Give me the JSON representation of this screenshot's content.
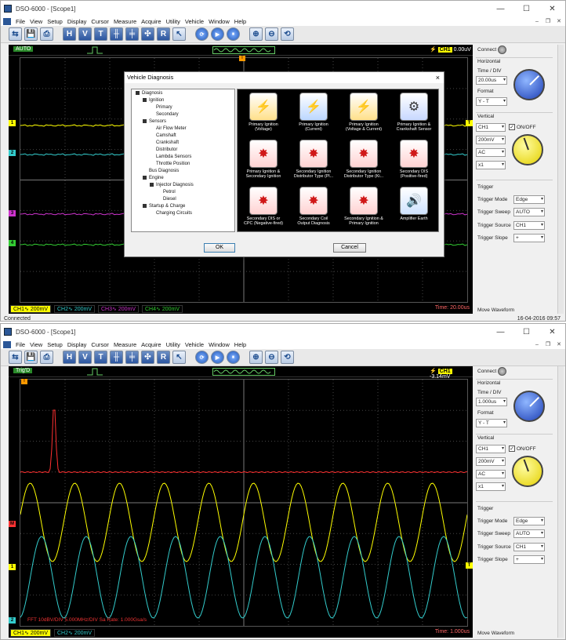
{
  "window1": {
    "title": "DSO-6000 - [Scope1]",
    "menu": [
      "File",
      "View",
      "Setup",
      "Display",
      "Cursor",
      "Measure",
      "Acquire",
      "Utility",
      "Vehicle",
      "Window",
      "Help"
    ],
    "mode_badge": "AUTO",
    "trigger_level": "0.00uV",
    "ch_tags": [
      "CH1∿ 200mV",
      "CH2∿ 200mV",
      "CH3∿ 200mV",
      "CH4∿ 200mV"
    ],
    "time_readout": "Time: 20.00us",
    "status": "Connected",
    "datetime": "16-04-2016   09:57",
    "side": {
      "connect": "Connect",
      "horizontal": "Horizontal",
      "time_div_label": "Time / DIV",
      "time_div": "20.00us",
      "format_label": "Format",
      "format": "Y - T",
      "vertical": "Vertical",
      "channel": "CH1",
      "on_off": "ON/OFF",
      "volts": "200mV",
      "coupling": "AC",
      "probe": "x1",
      "trigger": "Trigger",
      "trigger_mode_label": "Trigger Mode",
      "trigger_mode": "Edge",
      "trigger_sweep_label": "Trigger Sweep",
      "trigger_sweep": "AUTO",
      "trigger_source_label": "Trigger Source",
      "trigger_source": "CH1",
      "trigger_slope_label": "Trigger Slope",
      "trigger_slope": "+",
      "move_waveform": "Move Waveform"
    }
  },
  "dialog": {
    "title": "Vehicle Diagnosis",
    "close": "×",
    "tree": [
      {
        "label": "Diagnosis",
        "level": 0,
        "box": true
      },
      {
        "label": "Ignition",
        "level": 1,
        "box": true
      },
      {
        "label": "Primary",
        "level": 2,
        "box": false
      },
      {
        "label": "Secondary",
        "level": 2,
        "box": false
      },
      {
        "label": "Sensors",
        "level": 1,
        "box": true
      },
      {
        "label": "Air Flow Meter",
        "level": 2,
        "box": false
      },
      {
        "label": "Camshaft",
        "level": 2,
        "box": false
      },
      {
        "label": "Crankshaft",
        "level": 2,
        "box": false
      },
      {
        "label": "Distributor",
        "level": 2,
        "box": false
      },
      {
        "label": "Lambda Sensors",
        "level": 2,
        "box": false
      },
      {
        "label": "Throttle Position",
        "level": 2,
        "box": false
      },
      {
        "label": "Bus Diagnosis",
        "level": 1,
        "box": false
      },
      {
        "label": "Engine",
        "level": 1,
        "box": true
      },
      {
        "label": "Injector Diagnosis",
        "level": 2,
        "box": true
      },
      {
        "label": "Petrol",
        "level": 3,
        "box": false
      },
      {
        "label": "Diesel",
        "level": 3,
        "box": false
      },
      {
        "label": "Startup & Charge",
        "level": 1,
        "box": true
      },
      {
        "label": "Charging Circuits",
        "level": 2,
        "box": false
      }
    ],
    "tiles": [
      {
        "line1": "Primary Ignition",
        "line2": "(Voltage)",
        "glyph": "⚡"
      },
      {
        "line1": "Primary Ignition",
        "line2": "(Current)",
        "glyph": "⚡"
      },
      {
        "line1": "Primary Ignition",
        "line2": "(Voltage & Current)",
        "glyph": "⚡"
      },
      {
        "line1": "Primary Ignition &",
        "line2": "Crankshaft Sensor",
        "glyph": "⚙"
      },
      {
        "line1": "Primary Ignition &",
        "line2": "Secondary Ignition",
        "glyph": "✸"
      },
      {
        "line1": "Secondary Ignition",
        "line2": "Distributor Type (Pl...",
        "glyph": "✸"
      },
      {
        "line1": "Secondary Ignition",
        "line2": "Distributor Type (Ki...",
        "glyph": "✸"
      },
      {
        "line1": "Secondary DIS",
        "line2": "(Positive-fired)",
        "glyph": "✸"
      },
      {
        "line1": "Secondary DIS or",
        "line2": "CPC (Negative-fired)",
        "glyph": "✸"
      },
      {
        "line1": "Secondary Coil",
        "line2": "Output Diagnosis",
        "glyph": "✸"
      },
      {
        "line1": "Secondary Ignition &",
        "line2": "Primary Ignition",
        "glyph": "✸"
      },
      {
        "line1": "Amplifier Earth",
        "line2": "",
        "glyph": "🔊"
      }
    ],
    "ok": "OK",
    "cancel": "Cancel"
  },
  "window2": {
    "title": "DSO-6000 - [Scope1]",
    "menu": [
      "File",
      "View",
      "Setup",
      "Display",
      "Cursor",
      "Measure",
      "Acquire",
      "Utility",
      "Vehicle",
      "Window",
      "Help"
    ],
    "mode_badge": "Trig'D",
    "trigger_level": "-3.14mV",
    "ch_tags": [
      "CH1∿ 200mV",
      "CH2∿ 200mV"
    ],
    "time_readout": "Time: 1.000us",
    "fft_text": "FFT   10dBV/DIV   5.000MHz/DIV   Sa Rate: 1.000Gsa/s",
    "side": {
      "connect": "Connect",
      "horizontal": "Horizontal",
      "time_div_label": "Time / DIV",
      "time_div": "1.000us",
      "format_label": "Format",
      "format": "Y - T",
      "vertical": "Vertical",
      "channel": "CH1",
      "on_off": "ON/OFF",
      "volts": "200mV",
      "coupling": "AC",
      "probe": "x1",
      "trigger": "Trigger",
      "trigger_mode_label": "Trigger Mode",
      "trigger_mode": "Edge",
      "trigger_sweep_label": "Trigger Sweep",
      "trigger_sweep": "AUTO",
      "trigger_source_label": "Trigger Source",
      "trigger_source": "CH1",
      "trigger_slope_label": "Trigger Slope",
      "trigger_slope": "+",
      "move_waveform": "Move Waveform"
    }
  },
  "colors": {
    "ch1": "#ffff00",
    "ch2": "#33cccc",
    "ch3": "#cc33cc",
    "ch4": "#33cc33",
    "math": "#ff3030"
  },
  "toolbar_icons": [
    "connect-icon",
    "save-icon",
    "print-icon",
    "h-icon",
    "v-icon",
    "t-icon",
    "cursor1-icon",
    "cursor2-icon",
    "auto-measure-icon",
    "r-icon",
    "pointer-icon",
    "run-icon",
    "play-icon",
    "pause-icon",
    "zoom-in-icon",
    "zoom-out-icon",
    "refresh-icon"
  ]
}
